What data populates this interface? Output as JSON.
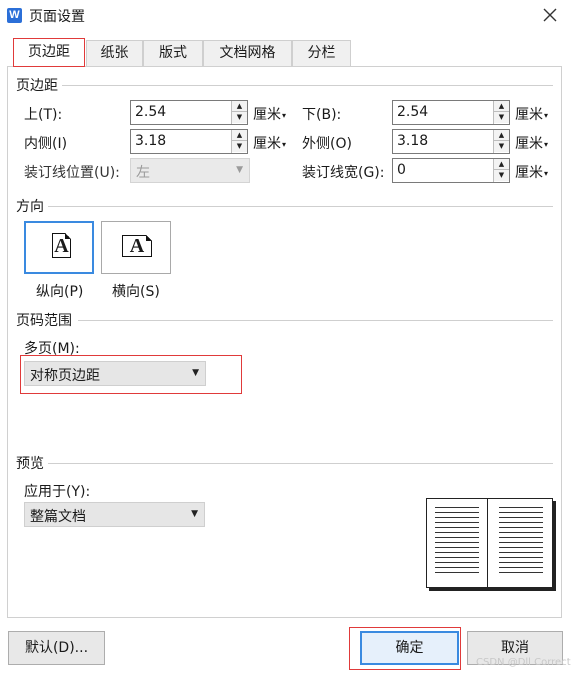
{
  "window": {
    "app_icon": "W",
    "title": "页面设置",
    "close_icon": "close-icon"
  },
  "tabs": [
    {
      "label": "页边距",
      "active": true
    },
    {
      "label": "纸张",
      "active": false
    },
    {
      "label": "版式",
      "active": false
    },
    {
      "label": "文档网格",
      "active": false
    },
    {
      "label": "分栏",
      "active": false
    }
  ],
  "margins": {
    "section_title": "页边距",
    "top_label": "上(T):",
    "top_value": "2.54",
    "bottom_label": "下(B):",
    "bottom_value": "2.54",
    "inside_label": "内侧(I)",
    "inside_value": "3.18",
    "outside_label": "外侧(O)",
    "outside_value": "3.18",
    "gutter_pos_label": "装订线位置(U):",
    "gutter_pos_value": "左",
    "gutter_width_label": "装订线宽(G):",
    "gutter_width_value": "0",
    "unit": "厘米"
  },
  "orientation": {
    "section_title": "方向",
    "glyph": "A",
    "portrait_label": "纵向(P)",
    "landscape_label": "横向(S)",
    "selected": "portrait"
  },
  "pages": {
    "section_title": "页码范围",
    "multiple_label": "多页(M):",
    "multiple_value": "对称页边距"
  },
  "preview": {
    "section_title": "预览",
    "apply_label": "应用于(Y):",
    "apply_value": "整篇文档"
  },
  "buttons": {
    "default_label": "默认(D)...",
    "ok_label": "确定",
    "cancel_label": "取消"
  },
  "watermark": "CSDN @Dll Correct",
  "colors": {
    "accent_blue": "#3a8ae0",
    "highlight_red": "#e03a3a",
    "app_icon_blue": "#2b6fd8"
  }
}
